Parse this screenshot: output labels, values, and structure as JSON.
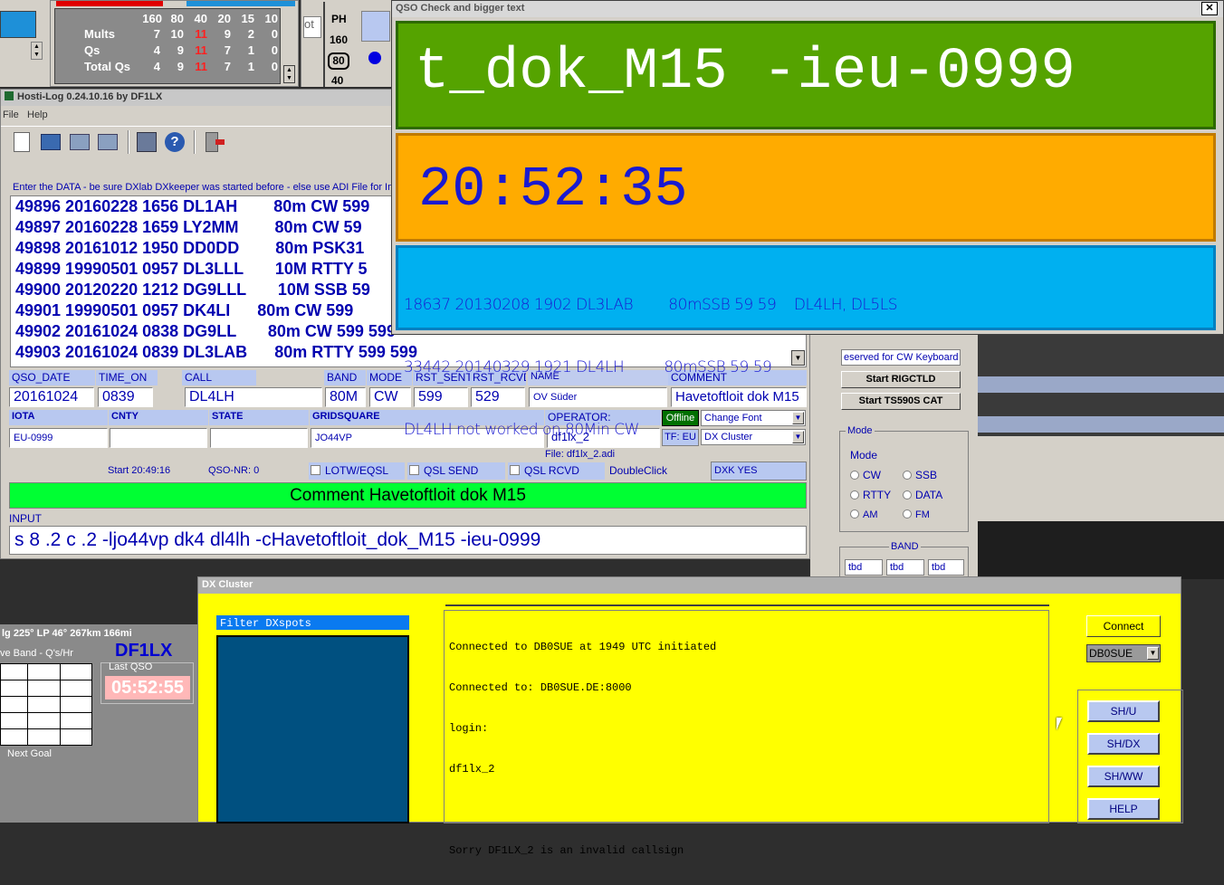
{
  "stats": {
    "bands": [
      "160",
      "80",
      "40",
      "20",
      "15",
      "10"
    ],
    "rows": [
      {
        "label": "Mults",
        "values": [
          "7",
          "10",
          "11",
          "9",
          "2",
          "0"
        ]
      },
      {
        "label": "Qs",
        "values": [
          "4",
          "9",
          "11",
          "7",
          "1",
          "0"
        ]
      },
      {
        "label": "Total Qs",
        "values": [
          "4",
          "9",
          "11",
          "7",
          "1",
          "0"
        ]
      }
    ],
    "ph_label": "PH",
    "ph_bands": [
      "160",
      "80",
      "40"
    ],
    "side_text": "ot"
  },
  "hosti": {
    "title": "Hosti-Log 0.24.10.16 by DF1LX",
    "menu": [
      "File",
      "Help"
    ],
    "data_hint": "Enter the DATA - be sure DXlab DXkeeper was started before - else use ADI File for Imp",
    "log_lines": [
      "49896 20160228 1656 DL1AH        80m CW 599",
      "49897 20160228 1659 LY2MM        80m CW 59",
      "49898 20161012 1950 DD0DD        80m PSK31",
      "49899 19990501 0957 DL3LLL       10M RTTY 5",
      "49900 20120220 1212 DG9LLL       10M SSB 59",
      "49901 19990501 0957 DK4LI      80m CW 599",
      "49902 20161024 0838 DG9LL       80m CW 599 599",
      "49903 20161024 0839 DL3LAB      80m RTTY 599 599"
    ],
    "headers1": {
      "qso_date": "QSO_DATE",
      "time_on": "TIME_ON",
      "call": "CALL",
      "band": "BAND",
      "mode": "MODE",
      "rst_sent": "RST_SENT",
      "rst_rcvd": "RST_RCVD",
      "name": "NAME",
      "comment": "COMMENT"
    },
    "values1": {
      "qso_date": "20161024",
      "time_on": "0839",
      "call": "DL4LH",
      "band": "80M",
      "mode": "CW",
      "rst_sent": "599",
      "rst_rcvd": "529",
      "name": "OV Süder",
      "comment": "Havetoftloit dok M15"
    },
    "headers2": {
      "iota": "IOTA",
      "cnty": "CNTY",
      "state": "STATE",
      "gridsquare": "GRIDSQUARE",
      "operator": "OPERATOR:"
    },
    "values2": {
      "iota": "EU-0999",
      "cnty": "",
      "state": "",
      "gridsquare": "JO44VP",
      "operator": "df1lx_2"
    },
    "offline_label": "Offline",
    "change_font": "Change Font",
    "tf_label": "TF: EU",
    "dx_cluster_select": "DX Cluster",
    "file_label": "File: df1lx_2.adi",
    "start_label": "Start 20:49:16",
    "qso_nr": "QSO-NR: 0",
    "lotw": "LOTW/EQSL",
    "qsl_send": "QSL SEND",
    "qsl_rcvd": "QSL RCVD",
    "doubleclick": "DoubleClick",
    "dxk_yes": "DXK YES",
    "comment_bar": "Comment  Havetoftloit dok M15",
    "input_label": "INPUT",
    "input_value": "s 8 .2 c .2 -ljo44vp dk4 dl4lh -cHavetoftloit_dok_M15 -ieu-0999"
  },
  "right_panel": {
    "cw_keyboard": "eserved for CW Keyboard",
    "start_rigctld": "Start  RIGCTLD",
    "start_cat": "Start  TS590S CAT",
    "mode_group": "Mode",
    "mode_label": "Mode",
    "modes": [
      "CW",
      "SSB",
      "RTTY",
      "DATA",
      "AM",
      "FM"
    ],
    "band_group": "BAND",
    "band_slots": [
      "tbd",
      "tbd",
      "tbd"
    ]
  },
  "qso_check": {
    "title": "QSO Check and bigger text",
    "close": "✕",
    "big_text": "t_dok_M15 -ieu-0999",
    "time": "20:52:35",
    "info_lines": [
      "18637 20130208 1902 DL3LAB        80mSSB 59 59    DL4LH, DL5LS",
      "33442 20140329 1921 DL4LH         80mSSB 59 59",
      "DL4LH not worked on 80Min CW"
    ]
  },
  "left_bottom": {
    "heading_line": "lg  225°  LP 46°  267km  166mi",
    "callsign": "DF1LX",
    "band_rate": "ve Band - Q's/Hr",
    "last_qso_label": "Last QSO",
    "last_qso_time": "05:52:55",
    "next_goal": "Next Goal"
  },
  "dx_cluster": {
    "title": "DX Cluster",
    "filter_label": "Filter DXspots",
    "console": [
      "Connected to DB0SUE at 1949 UTC initiated",
      "Connected to: DB0SUE.DE:8000",
      "login:",
      "df1lx_2",
      "",
      "Sorry DF1LX_2 is an invalid callsign"
    ],
    "connect": "Connect",
    "server": "DB0SUE",
    "commands": [
      "SH/U",
      "SH/DX",
      "SH/WW",
      "HELP"
    ]
  },
  "colors": {
    "green": "#55a300",
    "orange": "#ffab00",
    "cyan": "#00b0f0",
    "yellow": "#ffff00",
    "comment_green": "#00ff33",
    "text_blue": "#0000c8"
  }
}
